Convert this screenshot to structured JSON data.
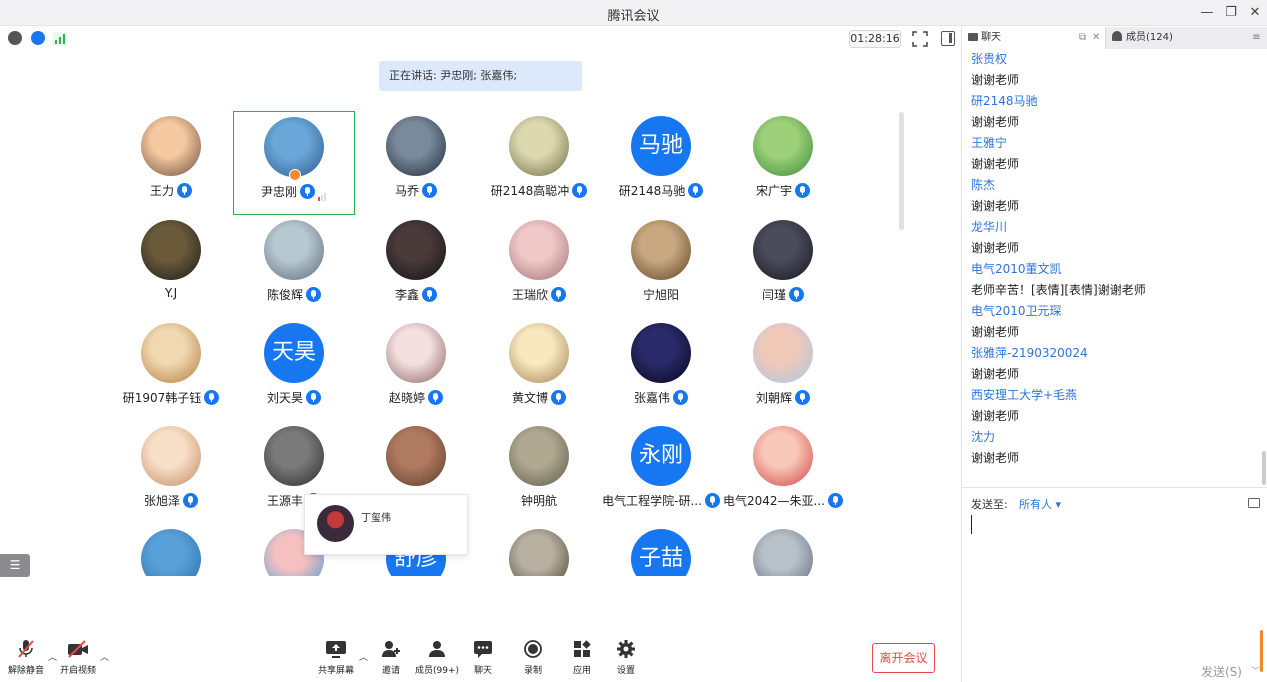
{
  "window": {
    "title": "腾讯会议"
  },
  "meeting": {
    "timer": "01:28:16",
    "speaking": "正在讲话: 尹忠刚; 张嘉伟;",
    "popup_name": "丁玺伟",
    "participants": [
      {
        "name": "王力",
        "mic": true
      },
      {
        "name": "尹忠刚",
        "mic": true,
        "active": true,
        "host": true
      },
      {
        "name": "马乔",
        "mic": true
      },
      {
        "name": "研2148高聪冲",
        "mic": true
      },
      {
        "name": "研2148马驰",
        "mic": true,
        "avatar_text": "马驰"
      },
      {
        "name": "宋广宇",
        "mic": true
      },
      {
        "name": "Y.J",
        "mic": false
      },
      {
        "name": "陈俊辉",
        "mic": true
      },
      {
        "name": "李鑫",
        "mic": true
      },
      {
        "name": "王瑞欣",
        "mic": true
      },
      {
        "name": "宁旭阳",
        "mic": false
      },
      {
        "name": "闫瑾",
        "mic": true
      },
      {
        "name": "研1907韩子钰",
        "mic": true
      },
      {
        "name": "刘天昊",
        "mic": true,
        "avatar_text": "天昊"
      },
      {
        "name": "赵晓婷",
        "mic": true
      },
      {
        "name": "黄文博",
        "mic": true
      },
      {
        "name": "张嘉伟",
        "mic": true
      },
      {
        "name": "刘朝辉",
        "mic": true
      },
      {
        "name": "张旭泽",
        "mic": true
      },
      {
        "name": "王源丰",
        "mic": true
      },
      {
        "name": "",
        "mic": false
      },
      {
        "name": "钟明航",
        "mic": false
      },
      {
        "name": "电气工程学院-研...",
        "mic": true,
        "avatar_text": "永刚"
      },
      {
        "name": "电气2042—朱亚...",
        "mic": true
      },
      {
        "name": "",
        "mic": false
      },
      {
        "name": "",
        "mic": false
      },
      {
        "name": "",
        "mic": false,
        "avatar_text": "舒彦"
      },
      {
        "name": "",
        "mic": false
      },
      {
        "name": "",
        "mic": false,
        "avatar_text": "子喆"
      },
      {
        "name": "",
        "mic": false
      }
    ]
  },
  "toolbar": {
    "unmute": "解除静音",
    "start_video": "开启视频",
    "share_screen": "共享屏幕",
    "invite": "邀请",
    "members": "成员(99+)",
    "chat": "聊天",
    "record": "录制",
    "apps": "应用",
    "settings": "设置",
    "leave": "离开会议"
  },
  "chat": {
    "tab_chat": "聊天",
    "tab_members": "成员(124)",
    "messages": [
      {
        "sender": "张贵权",
        "text": "谢谢老师"
      },
      {
        "sender": "研2148马驰",
        "text": "谢谢老师"
      },
      {
        "sender": "王雅宁",
        "text": "谢谢老师"
      },
      {
        "sender": "陈杰",
        "text": "谢谢老师"
      },
      {
        "sender": "龙华川",
        "text": "谢谢老师"
      },
      {
        "sender": "电气2010董文凯",
        "text": "老师辛苦！[表情][表情]谢谢老师"
      },
      {
        "sender": "电气2010卫元琛",
        "text": "谢谢老师"
      },
      {
        "sender": "张雅萍-2190320024",
        "text": "谢谢老师"
      },
      {
        "sender": "西安理工大学+毛燕",
        "text": "谢谢老师"
      },
      {
        "sender": "沈力",
        "text": "谢谢老师"
      }
    ],
    "send_to_label": "发送至:",
    "send_to_value": "所有人 ▾",
    "send_button": "发送(S)"
  },
  "colors": {
    "accent": "#1677f0",
    "active_border": "#2bb153",
    "leave": "#e14b4b",
    "sender": "#2f73d6"
  }
}
